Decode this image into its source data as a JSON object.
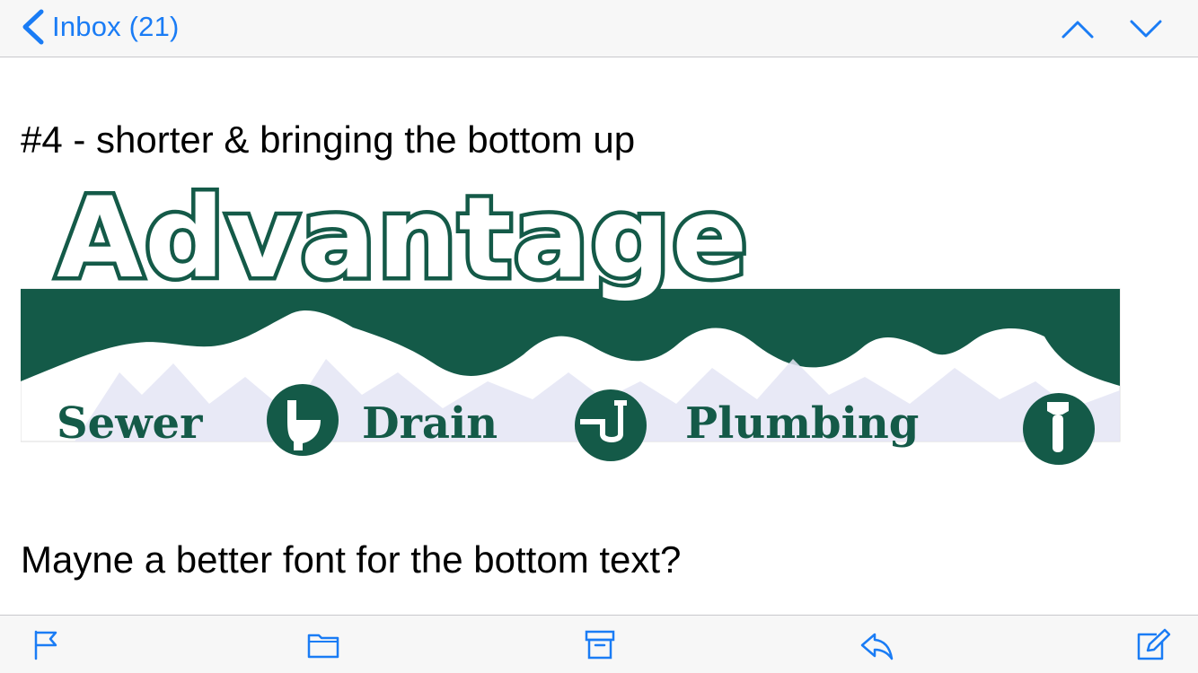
{
  "navbar": {
    "back_label": "Inbox (21)",
    "icons": [
      "chevron-left-icon",
      "chevron-up-icon",
      "chevron-down-icon"
    ]
  },
  "message": {
    "line1": "#4 - shorter & bringing the bottom up",
    "logo": {
      "title": "Advantage",
      "services": [
        "Sewer",
        "Drain",
        "Plumbing"
      ],
      "icons": [
        "toilet-icon",
        "drain-pipe-icon",
        "wrench-icon"
      ]
    },
    "line2": "Mayne a better font for the bottom text?"
  },
  "toolbar": {
    "icons": [
      "flag-icon",
      "folder-icon",
      "archive-icon",
      "reply-icon",
      "compose-icon"
    ]
  },
  "colors": {
    "accent": "#1a7cf5",
    "logo_green": "#145a48",
    "mountain": "#e4e5f5"
  }
}
